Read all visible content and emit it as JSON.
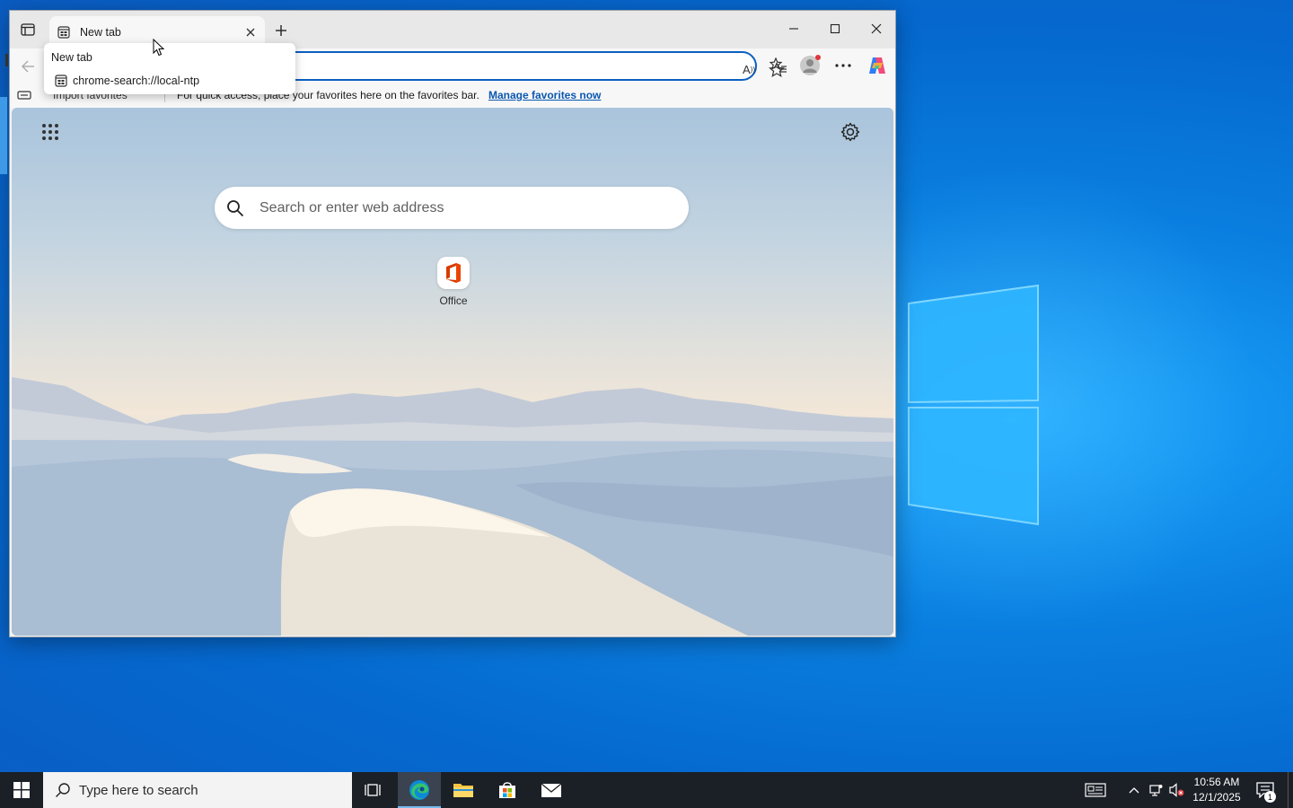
{
  "browser": {
    "tab": {
      "title": "New tab"
    },
    "hovercard": {
      "title": "New tab",
      "url": "chrome-search://local-ntp"
    },
    "toolbar": {
      "read_aloud_label": "A"
    },
    "favorites_bar": {
      "import_label": "Import favorites",
      "hint": "For quick access, place your favorites here on the favorites bar.",
      "manage_link": "Manage favorites now"
    },
    "ntp": {
      "search_placeholder": "Search or enter web address",
      "quick_links": [
        {
          "label": "Office",
          "icon": "office-icon"
        }
      ]
    }
  },
  "taskbar": {
    "search_placeholder": "Type here to search",
    "clock": {
      "time": "10:56 AM",
      "date": "12/1/2025"
    },
    "notification_count": "1",
    "apps": [
      "task-view",
      "edge",
      "file-explorer",
      "microsoft-store",
      "mail"
    ]
  },
  "colors": {
    "accent": "#0b5fbf",
    "taskbar": "#1b1f26",
    "desktop": "#0a7fe0"
  }
}
